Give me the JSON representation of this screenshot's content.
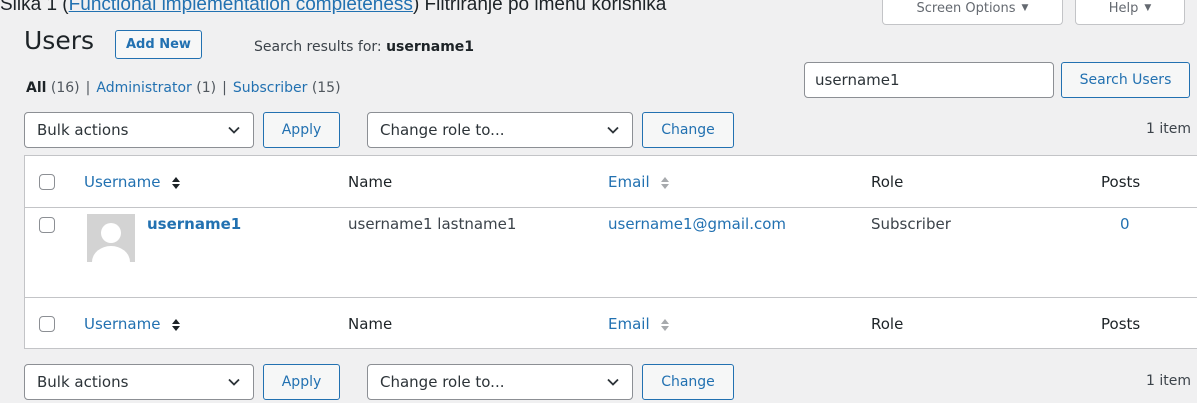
{
  "caption": {
    "prefix": "Slika 1 (",
    "link": "Functional implementation completeness",
    "suffix": ") Filtriranje po imenu korisnika"
  },
  "top_tabs": {
    "screen_options": "Screen Options",
    "help": "Help"
  },
  "header": {
    "title": "Users",
    "add_new": "Add New",
    "search_results_label": "Search results for:",
    "search_query": "username1"
  },
  "views": [
    {
      "label": "All",
      "count": "(16)",
      "current": true
    },
    {
      "label": "Administrator",
      "count": "(1)",
      "current": false
    },
    {
      "label": "Subscriber",
      "count": "(15)",
      "current": false
    }
  ],
  "search": {
    "value": "username1",
    "button": "Search Users"
  },
  "toolbar": {
    "bulk_actions": "Bulk actions",
    "apply": "Apply",
    "change_role": "Change role to...",
    "change": "Change",
    "item_count": "1 item"
  },
  "table": {
    "columns": {
      "username": "Username",
      "name": "Name",
      "email": "Email",
      "role": "Role",
      "posts": "Posts"
    },
    "rows": [
      {
        "username": "username1",
        "name": "username1 lastname1",
        "email": "username1@gmail.com",
        "role": "Subscriber",
        "posts": "0"
      }
    ]
  },
  "colors": {
    "link": "#2271b1",
    "background": "#f0f0f1",
    "text": "#1d2327"
  }
}
